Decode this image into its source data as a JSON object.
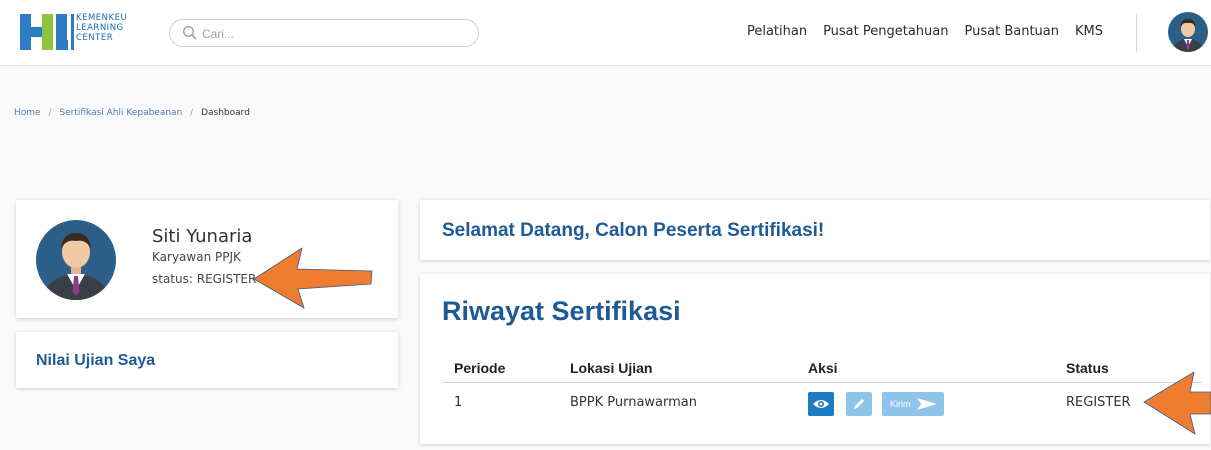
{
  "header": {
    "logo": {
      "mark": "KLC",
      "lines": [
        "KEMENKEU",
        "LEARNING",
        "CENTER"
      ]
    },
    "search": {
      "placeholder": "Cari..."
    },
    "nav": [
      "Pelatihan",
      "Pusat Pengetahuan",
      "Pusat Bantuan",
      "KMS"
    ]
  },
  "breadcrumb": {
    "items": [
      "Home",
      "Sertifikasi Ahli Kepabeanan",
      "Dashboard"
    ],
    "separator": "/"
  },
  "profile": {
    "name": "Siti Yunaria",
    "role": "Karyawan PPJK",
    "status": "status: REGISTER"
  },
  "nilai": {
    "title": "Nilai Ujian Saya"
  },
  "welcome": {
    "title": "Selamat Datang, Calon Peserta Sertifikasi!"
  },
  "riwayat": {
    "title": "Riwayat Sertifikasi",
    "columns": [
      "Periode",
      "Lokasi Ujian",
      "Aksi",
      "Status"
    ],
    "rows": [
      {
        "periode": "1",
        "lokasi": "BPPK Purnawarman",
        "status": "REGISTER"
      }
    ],
    "actions": {
      "view": "eye-icon",
      "edit": "pencil-icon",
      "kirim": "Kirim"
    }
  },
  "colors": {
    "brand_blue": "#1e5a96",
    "button_primary": "#1d7bc2",
    "button_light": "#8fc4ea",
    "arrow_orange": "#ee7d2f",
    "logo_blue": "#2e7dc4",
    "logo_green": "#8cc63f"
  }
}
